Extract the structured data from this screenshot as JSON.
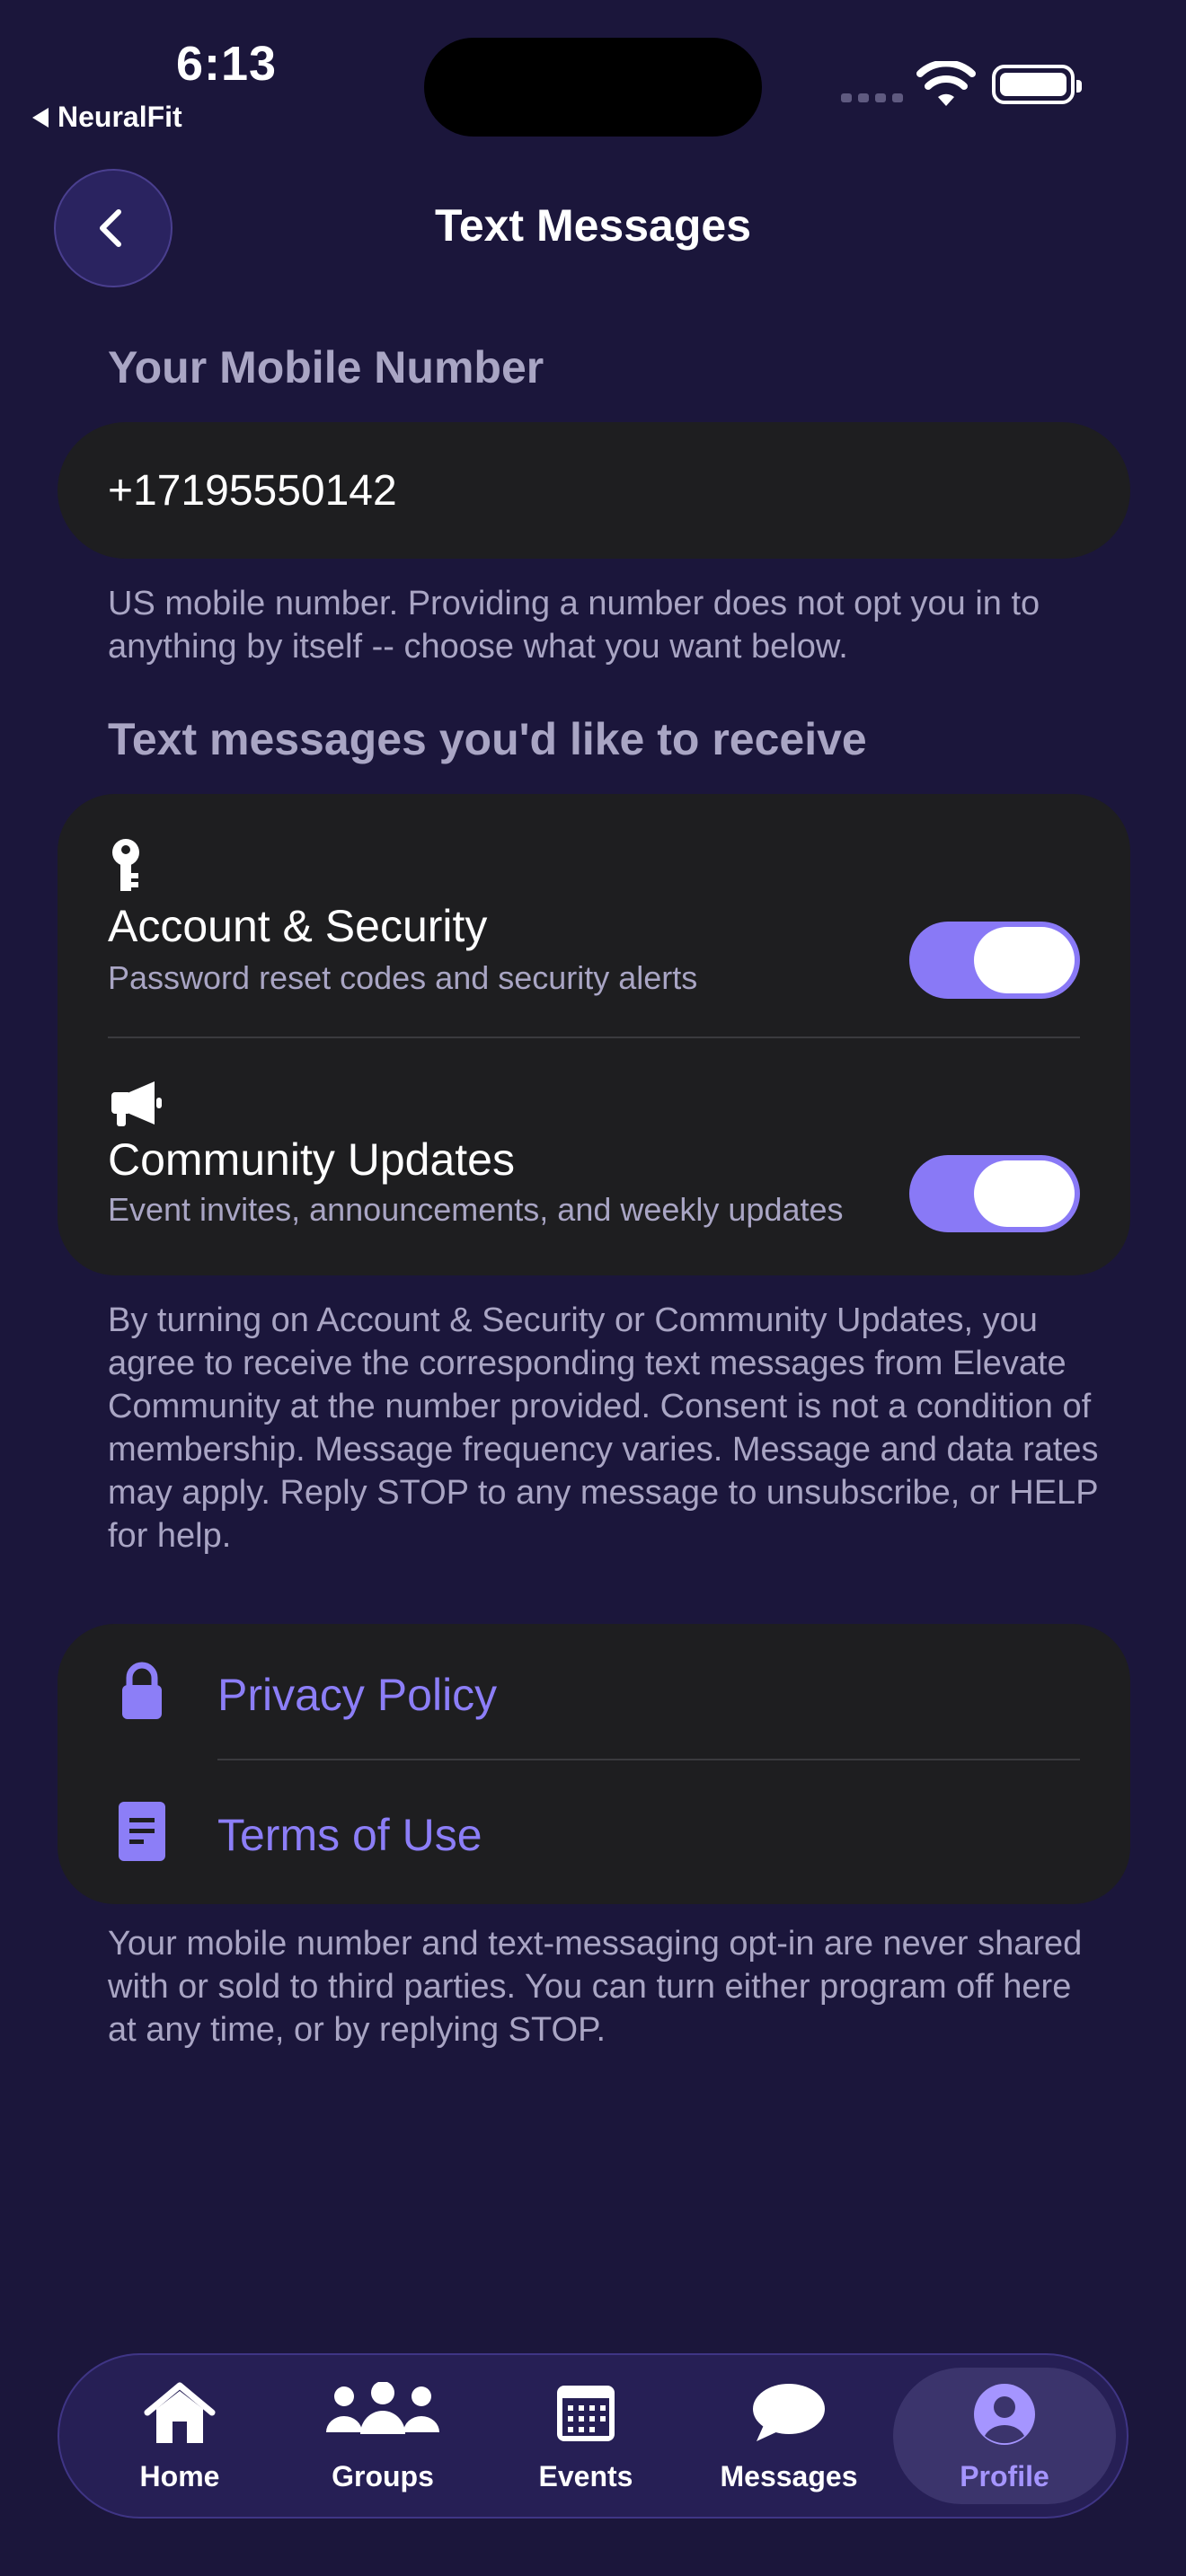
{
  "status_bar": {
    "time": "6:13",
    "back_app": "NeuralFit"
  },
  "header": {
    "title": "Text Messages"
  },
  "mobile": {
    "section_label": "Your Mobile Number",
    "phone_value": "+17195550142",
    "helper_text": "US mobile number. Providing a number does not opt you in to anything by itself -- choose what you want below."
  },
  "preferences": {
    "section_label": "Text messages you'd like to receive",
    "items": [
      {
        "icon": "key-icon",
        "title": "Account & Security",
        "subtitle": "Password reset codes and security alerts",
        "enabled": true
      },
      {
        "icon": "megaphone-icon",
        "title": "Community Updates",
        "subtitle": "Event invites, announcements, and weekly updates",
        "enabled": true
      }
    ],
    "consent_text": "By turning on Account & Security or Community Updates, you agree to receive the corresponding text messages from Elevate Community at the number provided. Consent is not a condition of membership. Message frequency varies. Message and data rates may apply. Reply STOP to any message to unsubscribe, or HELP for help."
  },
  "legal": {
    "links": [
      {
        "icon": "lock-icon",
        "label": "Privacy Policy"
      },
      {
        "icon": "document-icon",
        "label": "Terms of Use"
      }
    ],
    "footer_text": "Your mobile number and text-messaging opt-in are never shared with or sold to third parties. You can turn either program off here at any time, or by replying STOP."
  },
  "tabbar": {
    "tabs": [
      {
        "icon": "home-icon",
        "label": "Home"
      },
      {
        "icon": "groups-icon",
        "label": "Groups"
      },
      {
        "icon": "calendar-icon",
        "label": "Events"
      },
      {
        "icon": "chat-bubble-icon",
        "label": "Messages"
      },
      {
        "icon": "profile-icon",
        "label": "Profile",
        "active": true
      }
    ]
  },
  "colors": {
    "background": "#1b163b",
    "card": "#1e1e20",
    "accent": "#8979f6",
    "link": "#8c7ef7",
    "secondary_text": "#a9a5c4"
  }
}
